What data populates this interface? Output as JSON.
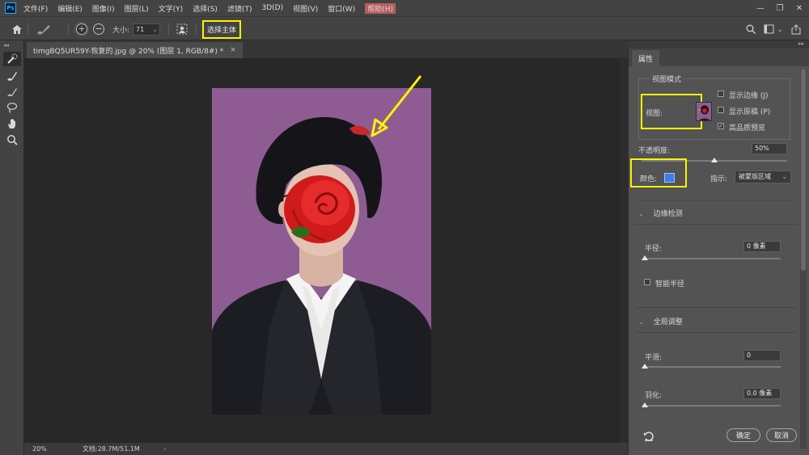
{
  "menubar": {
    "logo": "Ps",
    "items": [
      "文件(F)",
      "编辑(E)",
      "图像(I)",
      "图层(L)",
      "文字(Y)",
      "选择(S)",
      "滤镜(T)",
      "3D(D)",
      "视图(V)",
      "窗口(W)",
      "帮助(H)"
    ]
  },
  "options": {
    "size_label": "大小:",
    "size_value": "71",
    "select_subject": "选择主体"
  },
  "document": {
    "tab_title": "timgBQ5UR59Y-恢复的.jpg @ 20% (图层 1, RGB/8#) *",
    "zoom": "20%",
    "doc_size": "文档:28.7M/51.1M"
  },
  "panel": {
    "tab": "属性",
    "view_mode_legend": "视图模式",
    "view_label": "视图:",
    "show_edge": "显示边缘 (J)",
    "show_original": "显示原稿 (P)",
    "hq_preview": "高品质预览",
    "opacity_label": "不透明度:",
    "opacity_value": "50%",
    "color_label": "颜色:",
    "indicate_label": "指示:",
    "indicate_value": "被蒙版区域",
    "edge_detection": "边缘检测",
    "radius_label": "半径:",
    "radius_value": "0 像素",
    "smart_radius": "智能半径",
    "global_refine": "全局调整",
    "smooth_label": "平滑:",
    "smooth_value": "0",
    "feather_label": "羽化:",
    "feather_value": "0.0 像素",
    "ok": "确定",
    "cancel": "取消"
  },
  "state": {
    "show_edge_checked": false,
    "show_original_checked": false,
    "hq_preview_checked": true,
    "smart_radius_checked": false,
    "opacity_fraction": 0.5,
    "radius_fraction": 0,
    "smooth_fraction": 0,
    "feather_fraction": 0
  },
  "colors": {
    "accent_highlight": "#fff200",
    "mask_color": "#3d7ee8",
    "photo_background": "#8e5c93"
  },
  "icons": [
    "home-icon",
    "brush-tool-icon",
    "plus-circle-icon",
    "minus-circle-icon",
    "refine-edge-icon",
    "search-icon",
    "frame-icon",
    "workspace-icon",
    "share-icon",
    "quick-selection-icon",
    "refine-brush-icon",
    "brush-icon",
    "lasso-icon",
    "hand-icon",
    "zoom-icon",
    "reset-icon"
  ]
}
